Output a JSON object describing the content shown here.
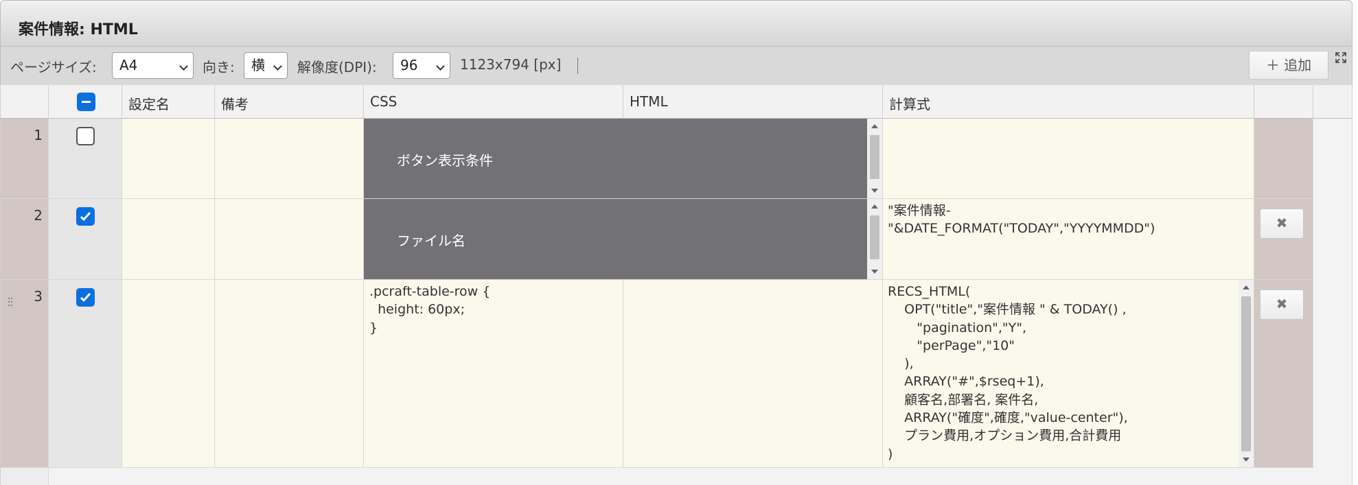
{
  "header": {
    "title": "案件情報: HTML"
  },
  "toolbar": {
    "page_size_label": "ページサイズ:",
    "page_size_value": "A4",
    "orientation_label": "向き:",
    "orientation_value": "横",
    "dpi_label": "解像度(DPI):",
    "dpi_value": "96",
    "dimensions": "1123x794 [px]",
    "add_label": "＋ 追加"
  },
  "columns": {
    "name": "設定名",
    "note": "備考",
    "css": "CSS",
    "html": "HTML",
    "formula": "計算式"
  },
  "rows": [
    {
      "num": "1",
      "checked": false,
      "name": "",
      "note": "",
      "css": "",
      "html": "",
      "merged_label": "ボタン表示条件",
      "formula": ""
    },
    {
      "num": "2",
      "checked": true,
      "name": "",
      "note": "",
      "css": "",
      "html": "",
      "merged_label": "ファイル名",
      "formula": "\"案件情報-\n\"&DATE_FORMAT(\"TODAY\",\"YYYYMMDD\")"
    },
    {
      "num": "3",
      "checked": true,
      "name": "",
      "note": "",
      "css": ".pcraft-table-row {\n  height: 60px;\n}",
      "html": "",
      "formula": "RECS_HTML(\n    OPT(\"title\",\"案件情報 \" & TODAY() ,\n       \"pagination\",\"Y\",\n       \"perPage\",\"10\"\n    ),\n    ARRAY(\"#\",$rseq+1),\n    顧客名,部署名, 案件名,\n    ARRAY(\"確度\",確度,\"value-center\"),\n    プラン費用,オプション費用,合計費用\n)"
    }
  ],
  "icons": {
    "delete": "✖",
    "expand": "expand-icon",
    "checkbox_mixed": "minus-square-icon"
  },
  "colors": {
    "accent": "#0b6fe0",
    "row_header": "#d2c7c4",
    "cell_bg": "#fbf9ec",
    "merged_bg": "#727276"
  }
}
